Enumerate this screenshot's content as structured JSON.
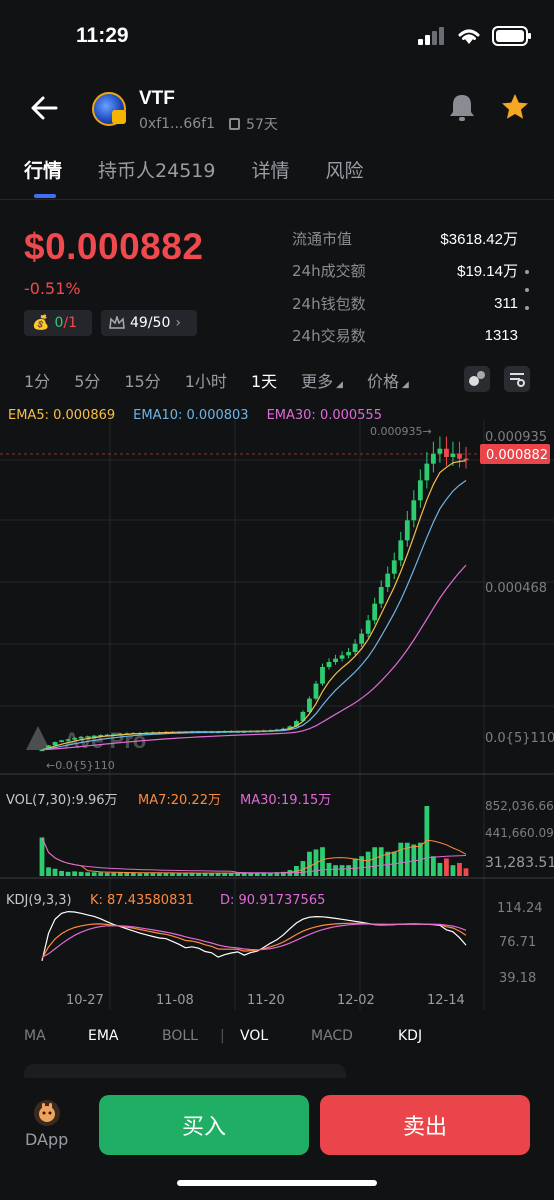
{
  "status": {
    "time": "11:29"
  },
  "token": {
    "name": "VTF",
    "address": "0xf1...66f1",
    "age": "57天"
  },
  "tabs": [
    "行情",
    "持币人24519",
    "详情",
    "风险"
  ],
  "price": {
    "value": "$0.000882",
    "change": "-0.51%"
  },
  "chips": {
    "chip1_value": "0",
    "chip1_total": "/1",
    "chip2_text": "49/50"
  },
  "stats": [
    {
      "label": "流通市值",
      "value": "$3618.42万"
    },
    {
      "label": "24h成交额",
      "value": "$19.14万"
    },
    {
      "label": "24h钱包数",
      "value": "311"
    },
    {
      "label": "24h交易数",
      "value": "1313"
    }
  ],
  "intervals": [
    "1分",
    "5分",
    "15分",
    "1小时",
    "1天",
    "更多",
    "价格"
  ],
  "ema": {
    "ema5": "EMA5: 0.000869",
    "ema10": "EMA10: 0.000803",
    "ema30": "EMA30: 0.000555"
  },
  "chart_data": {
    "type": "candlestick",
    "price_axis_labels": [
      "0.000935",
      "0.000468",
      "0.0{5}110"
    ],
    "current_price_tag": "0.000882",
    "high_marker": "0.000935",
    "low_marker": "0.0{5}110",
    "watermark": "Ave Pro",
    "x_labels": [
      "10-27",
      "11-08",
      "11-20",
      "12-02",
      "12-14"
    ],
    "closes": [
      1.2e-05,
      2.5e-05,
      3.5e-05,
      4e-05,
      4.3e-05,
      4.7e-05,
      5e-05,
      5.2e-05,
      5.4e-05,
      5.6e-05,
      5.7e-05,
      5.8e-05,
      6e-05,
      6.1e-05,
      6.2e-05,
      6.2e-05,
      6.3e-05,
      6.4e-05,
      6.4e-05,
      6.5e-05,
      6.5e-05,
      6.5e-05,
      6.5e-05,
      6.6e-05,
      6.6e-05,
      6.6e-05,
      6.6e-05,
      6.6e-05,
      6.7e-05,
      6.7e-05,
      6.7e-05,
      6.7e-05,
      6.8e-05,
      6.8e-05,
      6.9e-05,
      7e-05,
      7.2e-05,
      7.5e-05,
      8.2e-05,
      9.8e-05,
      0.000125,
      0.000165,
      0.00021,
      0.00026,
      0.000275,
      0.000285,
      0.000295,
      0.000305,
      0.00033,
      0.00036,
      0.0004,
      0.00045,
      0.0005,
      0.00054,
      0.00058,
      0.00064,
      0.0007,
      0.00076,
      0.00082,
      0.00087,
      0.0009,
      0.000915,
      0.00089,
      0.0009,
      0.000885,
      0.000882
    ],
    "volume": {
      "label": "VOL(7,30):9.96万",
      "ma7": "MA7:20.22万",
      "ma30": "MA30:19.15万",
      "axis": [
        "852,036.66",
        "441,660.09",
        "31,283.51"
      ]
    },
    "kdj": {
      "label": "KDJ(9,3,3)",
      "k": "K:  87.43580831",
      "d": "D:  90.91737565",
      "axis": [
        "114.24",
        "76.71",
        "39.18"
      ]
    }
  },
  "indicator_tabs": [
    "MA",
    "EMA",
    "BOLL",
    "VOL",
    "MACD",
    "KDJ"
  ],
  "bottom": {
    "dapp": "DApp",
    "buy": "买入",
    "sell": "卖出"
  },
  "colors": {
    "up": "#2ecc71",
    "down": "#f04a4e",
    "ema5": "#f5c04a",
    "ema10": "#6fb4e6",
    "ema30": "#e06ad6"
  }
}
